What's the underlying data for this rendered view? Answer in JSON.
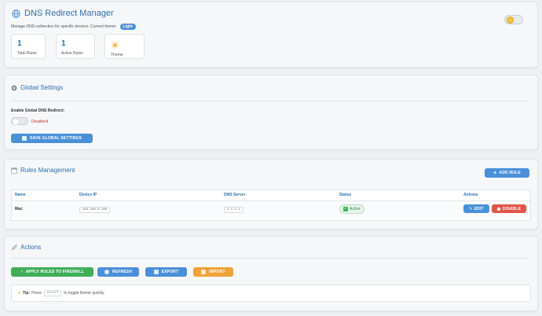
{
  "header": {
    "title": "DNS Redirect Manager",
    "subtitle": "Manage DNS redirection for specific devices. Current theme:",
    "theme_badge": "Light",
    "stats": [
      {
        "value": "1",
        "label": "Total Rules"
      },
      {
        "value": "1",
        "label": "Active Rules"
      },
      {
        "value": "",
        "label": "Theme"
      }
    ],
    "theme_toggle_on": true
  },
  "global_settings": {
    "title": "Global Settings",
    "enable_label": "Enable Global DNS Redirect:",
    "status": "Disabled",
    "save_button": "SAVE GLOBAL SETTINGS"
  },
  "rules": {
    "title": "Rules Management",
    "add_button": "ADD RULE",
    "columns": [
      "Name",
      "Device IP",
      "DNS Server",
      "Status",
      "Actions"
    ],
    "rows": [
      {
        "name": "Mac",
        "device_ip": "192.168.0.100",
        "dns_server": "1.1.1.1",
        "status": "Active",
        "edit": "EDIT",
        "disable": "DISABLE"
      }
    ]
  },
  "actions": {
    "title": "Actions",
    "buttons": {
      "apply": "APPLY RULES TO FIREWALL",
      "refresh": "REFRESH",
      "export": "EXPORT",
      "import": "IMPORT"
    },
    "tip_bold": "Tip:",
    "tip_pre": "Press",
    "tip_key": "Ctrl+T",
    "tip_post": "to toggle theme quickly."
  },
  "colors": {
    "primary": "#4a90d9",
    "success": "#3fae5a",
    "danger": "#e05547",
    "warning": "#efa13a",
    "heading": "#2d6fae"
  }
}
